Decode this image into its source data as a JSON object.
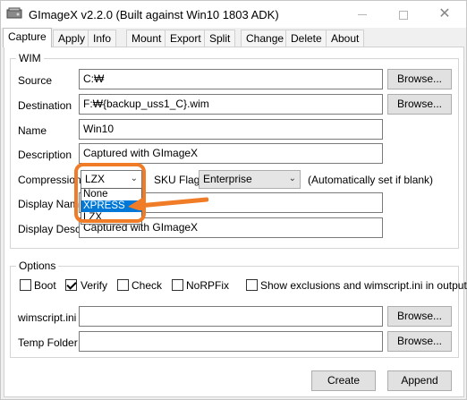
{
  "window": {
    "title": "GImageX v2.2.0 (Built against Win10 1803 ADK)",
    "close_glyph": "✕"
  },
  "tabs": [
    "Capture",
    "Apply",
    "Info",
    "Mount",
    "Export",
    "Split",
    "Change",
    "Delete",
    "About"
  ],
  "wim": {
    "group_label": "WIM",
    "source_label": "Source",
    "source_value": "C:₩",
    "destination_label": "Destination",
    "destination_value": "F:₩{backup_uss1_C}.wim",
    "name_label": "Name",
    "name_value": "Win10",
    "description_label": "Description",
    "description_value": "Captured with GImageX",
    "compression_label": "Compression",
    "compression_value": "LZX",
    "compression_options": [
      "None",
      "XPRESS",
      "LZX"
    ],
    "compression_highlighted": "XPRESS",
    "sku_flag_label": "SKU Flag",
    "sku_flag_value": "Enterprise",
    "sku_hint": "(Automatically set if blank)",
    "display_name_label": "Display Name",
    "display_name_value": "",
    "display_desc_label": "Display Desc.",
    "display_desc_value": "Captured with GImageX",
    "browse_label": "Browse..."
  },
  "options": {
    "group_label": "Options",
    "boot_label": "Boot",
    "boot_checked": false,
    "verify_label": "Verify",
    "verify_checked": true,
    "check_label": "Check",
    "check_checked": false,
    "norpfix_label": "NoRPFix",
    "norpfix_checked": false,
    "exclusions_label": "Show exclusions and wimscript.ini in output",
    "exclusions_checked": false,
    "wimscript_label": "wimscript.ini",
    "wimscript_value": "",
    "temp_folder_label": "Temp Folder",
    "temp_folder_value": "",
    "browse_label": "Browse..."
  },
  "actions": {
    "create_label": "Create",
    "append_label": "Append"
  },
  "colors": {
    "annotation": "#f07c28",
    "selection": "#0078d7"
  }
}
